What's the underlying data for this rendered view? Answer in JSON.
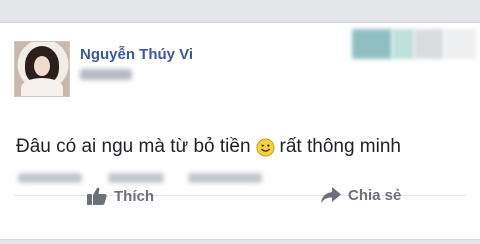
{
  "post": {
    "author_name": "Nguyễn Thúy Vi",
    "message_before_emoji": "Đâu có ai ngu mà từ bỏ tiền",
    "emoji": "smiley-emoji",
    "message_after_emoji": "rất thông minh"
  },
  "actions": {
    "like_label": "Thích",
    "like_icon": "thumbs-up-icon",
    "share_label": "Chia sẻ",
    "share_icon": "share-arrow-icon"
  },
  "colors": {
    "author": "#3b5998",
    "message": "#1d2129",
    "action": "#6b7079",
    "emoji_fill": "#f7d23e"
  }
}
